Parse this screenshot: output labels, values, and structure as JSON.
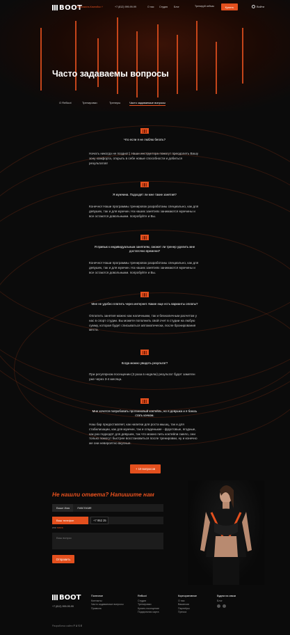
{
  "header": {
    "logo": "BOOT",
    "city": "Махачкала-Каспийск ˅",
    "phone": "+7 (812) 999-99-99",
    "nav": [
      "О нас",
      "Студия",
      "Блог"
    ],
    "training_now": "Тренируй сейчас",
    "buy_label": "Купить",
    "login_label": "Войти"
  },
  "page": {
    "title": "Часто задаваемы вопросы",
    "tabs": [
      "О ReBoot",
      "Тренировки",
      "Тренеры",
      "Часто задаваемые вопросы"
    ]
  },
  "faq": [
    {
      "question": "Что если я не люблю бегать?",
      "answer": "Начать никогда не поздно!:) Наши инструктора помогут преодолеть Вашу зону комфорта, открыть в себе новые способности и добиться результатов!"
    },
    {
      "question": "Я мужчина. Подходят ли мне такие занятия?",
      "answer": "Конечно! Наши программы тренировок разработаны специально, как для девушек, так и для мужчин. На наших занятиях занимаются мужчины и все остаются довольными. попробуйте и Вы."
    },
    {
      "question": "Я привык к индивидуальным занятиям, сможет ли тренер уделить мне достаточно времени?",
      "answer": "Конечно! Наши программы тренировок разработаны специально, как для девушек, так и для мужчин. На наших занятиях занимаются мужчины и все остаются довольными. попробуйте и Вы."
    },
    {
      "question": "Мне не удобно платить через интернет. Какие еще есть варианты оплаты?",
      "answer": "Оплатить занятия можно как наличными, так и безналичным расчетом у нас в спорт студии. Вы можете пополнить свой счет в студии на любую сумму, которая будет списываться автоматически, после бронирования места."
    },
    {
      "question": "Когда можно увидеть результат?",
      "answer": "При регулярном посещении (3 раза в неделю) результат будет заметен уже через 3-4 месяца."
    },
    {
      "question": "Мне хочется попробовать протеиновый коктейль, но я девушка и я боюсь стать качком.",
      "answer": "Наш бар предоставляет, как напитки для роста мышц, так и для стабилизации, как для мужчин, так и сладенькие - фруктовые, ягодные, как раз подходят для девушек, так что можно пить коктейли смело, они только помогут быстрее восстановиться после тренировки, ну и конечно же они невероятно вкусные."
    }
  ],
  "more_button": "+ 10 вопросов",
  "form": {
    "title": "Не нашли ответа? Напишите нам",
    "name_label": "Ваше Имя",
    "name_value": "Анастасия",
    "phone_label": "Ваш телефон",
    "phone_value": "+7 952 25",
    "or_text": "или",
    "mail_link": "почта",
    "question_placeholder": "Ваш вопрос",
    "send_label": "Отправить"
  },
  "footer": {
    "logo": "BOOT",
    "phone": "+7 (812) 999-99-99",
    "columns": [
      {
        "title": "Полезное",
        "items": [
          "Контакты",
          "Часто задаваемые вопросы",
          "Правила"
        ]
      },
      {
        "title": "ReBoot",
        "items": [
          "Студии",
          "Тренировки",
          "Купить посещение",
          "Подарочная карта"
        ]
      },
      {
        "title": "Корпоративное",
        "items": [
          "О нас",
          "Вакансии",
          "Партнёры",
          "Пресса"
        ]
      },
      {
        "title": "Будем на связи",
        "items": [
          "Блог"
        ]
      }
    ],
    "dev_text": "Разработка сайта",
    "dev_brand": "FUSE"
  },
  "colors": {
    "accent": "#e4501e",
    "background": "#0b0b0b"
  }
}
